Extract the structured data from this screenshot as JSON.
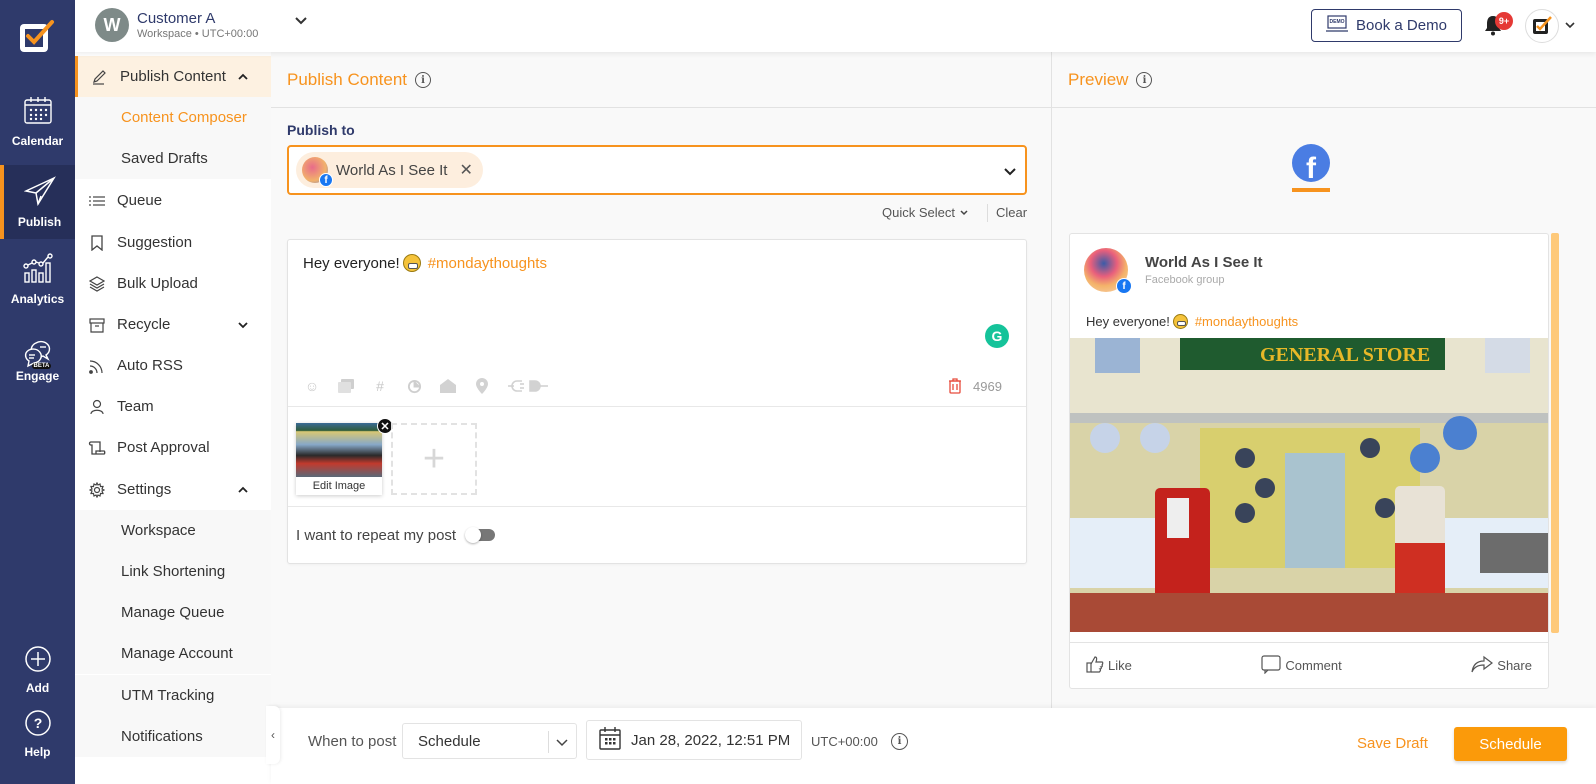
{
  "rail": {
    "items": [
      {
        "label": "Calendar",
        "icon": "calendar-icon"
      },
      {
        "label": "Publish",
        "icon": "paper-plane-icon",
        "active": true
      },
      {
        "label": "Analytics",
        "icon": "analytics-icon"
      },
      {
        "label": "Engage",
        "icon": "chat-bubbles-icon",
        "badge": "BETA"
      },
      {
        "label": "Add",
        "icon": "plus-circle-icon"
      },
      {
        "label": "Help",
        "icon": "help-circle-icon"
      }
    ]
  },
  "header": {
    "workspace_initial": "W",
    "workspace_name": "Customer A",
    "workspace_sub": "Workspace • UTC+00:00",
    "book_demo_label": "Book a Demo",
    "notification_badge": "9+"
  },
  "sidemenu": {
    "publish_content": "Publish Content",
    "content_composer": "Content Composer",
    "saved_drafts": "Saved Drafts",
    "queue": "Queue",
    "suggestion": "Suggestion",
    "bulk_upload": "Bulk Upload",
    "recycle": "Recycle",
    "auto_rss": "Auto RSS",
    "team": "Team",
    "post_approval": "Post Approval",
    "settings": "Settings",
    "settings_items": [
      "Workspace",
      "Link Shortening",
      "Manage Queue",
      "Manage Account",
      "UTM Tracking",
      "Notifications"
    ]
  },
  "composer": {
    "title": "Publish Content",
    "publish_to_label": "Publish to",
    "selected_account": "World As I See It",
    "quick_select": "Quick Select",
    "clear": "Clear",
    "text": "Hey everyone!",
    "hashtag": "#mondaythoughts",
    "char_remaining": "4969",
    "edit_image_label": "Edit Image",
    "repeat_label": "I want to repeat my post",
    "repeat_enabled": false
  },
  "preview": {
    "title": "Preview",
    "account_name": "World As I See It",
    "account_type": "Facebook group",
    "text": "Hey everyone!",
    "hashtag": "#mondaythoughts",
    "actions": {
      "like": "Like",
      "comment": "Comment",
      "share": "Share"
    }
  },
  "bottombar": {
    "when_label": "When to post",
    "when_value": "Schedule",
    "datetime": "Jan 28, 2022, 12:51 PM",
    "timezone": "UTC+00:00",
    "save_draft": "Save Draft",
    "schedule": "Schedule"
  },
  "colors": {
    "accent": "#f7931e",
    "rail": "#2f3a6b",
    "facebook": "#1877f2",
    "grammarly": "#15c39a"
  }
}
